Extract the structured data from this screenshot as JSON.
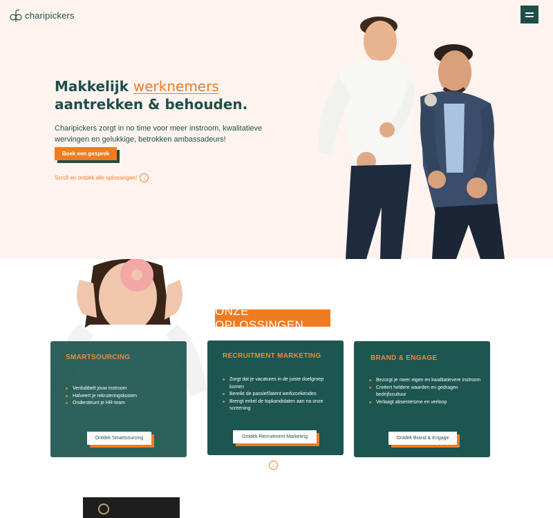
{
  "brand": {
    "name": "charipickers"
  },
  "hero": {
    "headline_prefix": "Makkelijk",
    "headline_accent": "werknemers",
    "headline_line2": "aantrekken & behouden.",
    "lead": "Charipickers zorgt in no time voor meer instroom, kwalitatieve wervingen en gelukkige, betrokken ambassadeurs!",
    "cta_label": "Boek een gesprek",
    "scroll_label": "Scroll en ontdek alle oplossingen!"
  },
  "solutions": {
    "title": "ONZE OPLOSSINGEN",
    "cards": [
      {
        "title": "SMARTSOURCING",
        "bullets": [
          "Verdubbelt jouw instroom",
          "Halveert je rekruteringskosten",
          "Ondersteunt je HR-team"
        ],
        "button": "Ontdek Smartsourcing"
      },
      {
        "title": "RECRUITMENT MARKETING",
        "bullets": [
          "Zorgt dat je vacatures in de juiste doelgroep komen",
          "Bereikt de passief/latent werkzoekenden",
          "Brengt enkel de topkandidaten aan na onze screening"
        ],
        "button": "Ontdek Recruitment Marketing"
      },
      {
        "title": "BRAND & ENGAGE",
        "bullets": [
          "Bezorgt je meer eigen en kwalitatievere instroom",
          "Creëert heldere waarden en gedragen bedrijfscultuur",
          "Verlaagt absenteïsme en verloop"
        ],
        "button": "Ontdek Brand & Engage"
      }
    ]
  },
  "colors": {
    "teal": "#1d4f4a",
    "orange": "#f07c22",
    "hero_bg": "#fef3ee"
  },
  "icons": {
    "menu": "hamburger-icon",
    "scroll": "arrow-down-circle-icon"
  }
}
